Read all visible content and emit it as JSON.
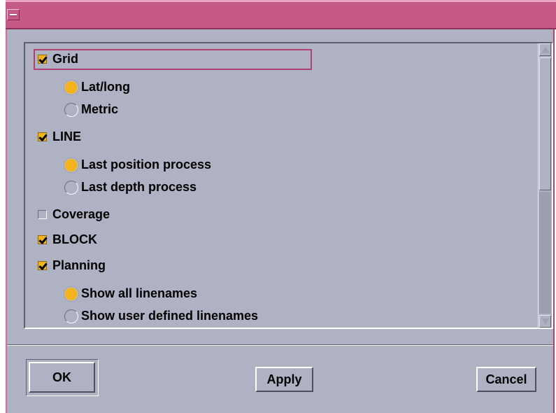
{
  "window": {
    "title": ""
  },
  "options": {
    "grid": {
      "label": "Grid",
      "checked": true
    },
    "grid_modes": [
      {
        "label": "Lat/long",
        "selected": true
      },
      {
        "label": "Metric",
        "selected": false
      }
    ],
    "line": {
      "label": "LINE",
      "checked": true
    },
    "line_modes": [
      {
        "label": "Last position process",
        "selected": true
      },
      {
        "label": "Last depth process",
        "selected": false
      }
    ],
    "coverage": {
      "label": "Coverage",
      "checked": false
    },
    "block": {
      "label": "BLOCK",
      "checked": true
    },
    "planning": {
      "label": "Planning",
      "checked": true
    },
    "planning_modes": [
      {
        "label": "Show all linenames",
        "selected": true
      },
      {
        "label": "Show user defined linenames",
        "selected": false
      }
    ]
  },
  "scroll": {
    "position_fraction": 0.0,
    "visible_fraction": 0.55
  },
  "buttons": {
    "ok": "OK",
    "apply": "Apply",
    "cancel": "Cancel"
  },
  "colors": {
    "titlebar": "#c55a86",
    "background": "#aeb2c3",
    "accent": "#f3b31c",
    "focus": "#b04070"
  }
}
